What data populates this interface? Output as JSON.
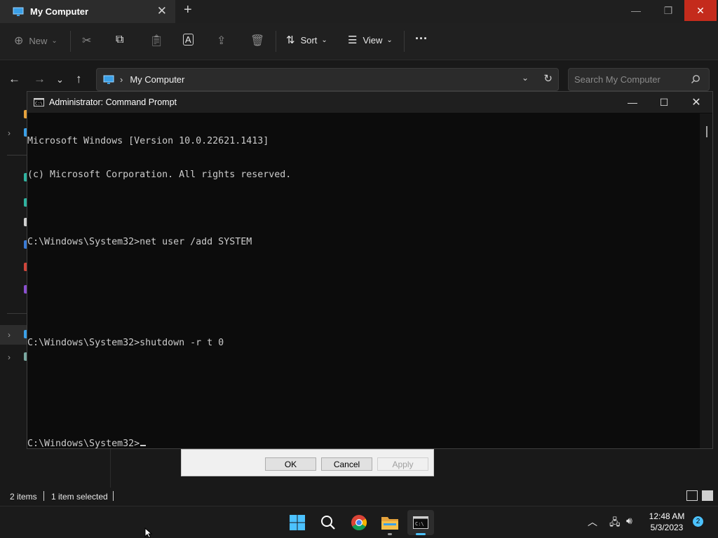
{
  "explorer": {
    "tab_title": "My Computer",
    "toolbar": {
      "new_label": "New",
      "sort_label": "Sort",
      "view_label": "View",
      "more_label": "···"
    },
    "breadcrumb": "My Computer",
    "search_placeholder": "Search My Computer",
    "status": {
      "items_count": "2 items",
      "selection": "1 item selected"
    }
  },
  "properties_dialog": {
    "ok_label": "OK",
    "cancel_label": "Cancel",
    "apply_label": "Apply"
  },
  "cmd": {
    "title": "Administrator: Command Prompt",
    "lines": [
      "Microsoft Windows [Version 10.0.22621.1413]",
      "(c) Microsoft Corporation. All rights reserved.",
      "",
      "C:\\Windows\\System32>net user /add SYSTEM",
      "",
      "",
      "C:\\Windows\\System32>shutdown -r t 0",
      "",
      "",
      "C:\\Windows\\System32>"
    ]
  },
  "taskbar": {
    "apps": [
      "start-icon",
      "search-icon",
      "chrome-icon",
      "file-explorer-icon",
      "terminal-icon"
    ],
    "clock_time": "12:48 AM",
    "clock_date": "5/3/2023",
    "notification_count": "2"
  },
  "colors": {
    "accent": "#4cc2ff",
    "close_red": "#c42b1c",
    "console_bg": "#0c0c0c",
    "console_text": "#cccccc"
  }
}
